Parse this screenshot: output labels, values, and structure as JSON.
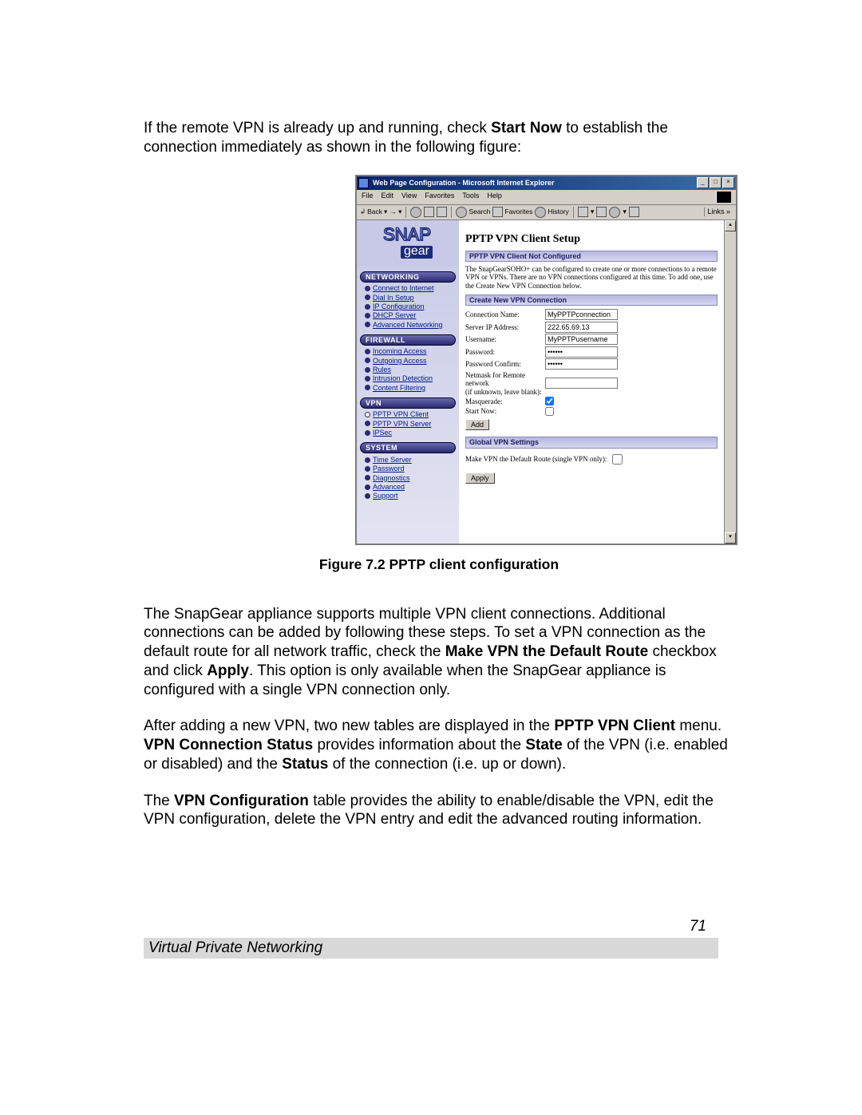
{
  "intro_paragraph": {
    "pre": "If the remote VPN is already up and running, check ",
    "bold": "Start Now",
    "post": " to establish the connection immediately as shown in the following figure:"
  },
  "figure_caption": "Figure 7.2 PPTP client configuration",
  "para2_parts": [
    {
      "t": "The SnapGear appliance supports multiple VPN client connections. Additional connections can be added by following these steps. To set a VPN connection as the default route for all network traffic, check the "
    },
    {
      "t": "Make VPN the Default Route",
      "b": true
    },
    {
      "t": " checkbox and click "
    },
    {
      "t": "Apply",
      "b": true
    },
    {
      "t": ". This option is only available when the SnapGear appliance is configured with a single VPN connection only."
    }
  ],
  "para3_parts": [
    {
      "t": "After adding a new VPN, two new tables are displayed in the "
    },
    {
      "t": "PPTP VPN Client",
      "b": true
    },
    {
      "t": " menu. "
    },
    {
      "t": "VPN Connection Status",
      "b": true
    },
    {
      "t": " provides information about the "
    },
    {
      "t": "State",
      "b": true
    },
    {
      "t": " of the VPN (i.e. enabled or disabled) and the "
    },
    {
      "t": "Status",
      "b": true
    },
    {
      "t": " of the connection (i.e. up or down)."
    }
  ],
  "para4_parts": [
    {
      "t": "The "
    },
    {
      "t": "VPN Configuration",
      "b": true
    },
    {
      "t": " table provides the ability to enable/disable the VPN, edit the VPN configuration, delete the VPN entry and edit the advanced routing information."
    }
  ],
  "page_number": "71",
  "footer": "Virtual Private Networking",
  "window": {
    "title": "Web Page Configuration - Microsoft Internet Explorer",
    "menu": [
      "File",
      "Edit",
      "View",
      "Favorites",
      "Tools",
      "Help"
    ],
    "toolbar": {
      "back": "Back",
      "search": "Search",
      "favorites": "Favorites",
      "history": "History",
      "links": "Links"
    },
    "logo": {
      "top": "SNAP",
      "bottom": "gear"
    },
    "nav": [
      {
        "header": "NETWORKING",
        "items": [
          {
            "label": "Connect to Internet"
          },
          {
            "label": "Dial In Setup"
          },
          {
            "label": "IP Configuration"
          },
          {
            "label": "DHCP Server"
          },
          {
            "label": "Advanced Networking"
          }
        ]
      },
      {
        "header": "FIREWALL",
        "items": [
          {
            "label": "Incoming Access"
          },
          {
            "label": "Outgoing Access"
          },
          {
            "label": "Rules"
          },
          {
            "label": "Intrusion Detection"
          },
          {
            "label": "Content Filtering"
          }
        ]
      },
      {
        "header": "VPN",
        "items": [
          {
            "label": "PPTP VPN Client",
            "open": true
          },
          {
            "label": "PPTP VPN Server"
          },
          {
            "label": "IPSec"
          }
        ]
      },
      {
        "header": "SYSTEM",
        "items": [
          {
            "label": "Time Server"
          },
          {
            "label": "Password"
          },
          {
            "label": "Diagnostics"
          },
          {
            "label": "Advanced"
          },
          {
            "label": "Support"
          }
        ]
      }
    ],
    "main": {
      "heading": "PPTP VPN Client Setup",
      "bar1": "PPTP VPN Client Not Configured",
      "description": "The SnapGearSOHO+ can be configured to create one or more connections to a remote VPN or VPNs. There are no VPN connections configured at this time. To add one, use the Create New VPN Connection below.",
      "bar2": "Create New VPN Connection",
      "fields": {
        "conn_name_lbl": "Connection Name:",
        "conn_name_val": "MyPPTPconnection",
        "server_ip_lbl": "Server IP Address:",
        "server_ip_val": "222.65.69.13",
        "username_lbl": "Username:",
        "username_val": "MyPPTPusername",
        "password_lbl": "Password:",
        "password_val": "******",
        "password2_lbl": "Password Confirm:",
        "password2_val": "******",
        "netmask_lbl": "Netmask for Remote network\n(if unknown, leave blank):",
        "masq_lbl": "Masquerade:",
        "startnow_lbl": "Start Now:",
        "add_btn": "Add"
      },
      "bar3": "Global VPN Settings",
      "global_lbl": "Make VPN the Default Route (single VPN only):",
      "apply_btn": "Apply"
    }
  }
}
